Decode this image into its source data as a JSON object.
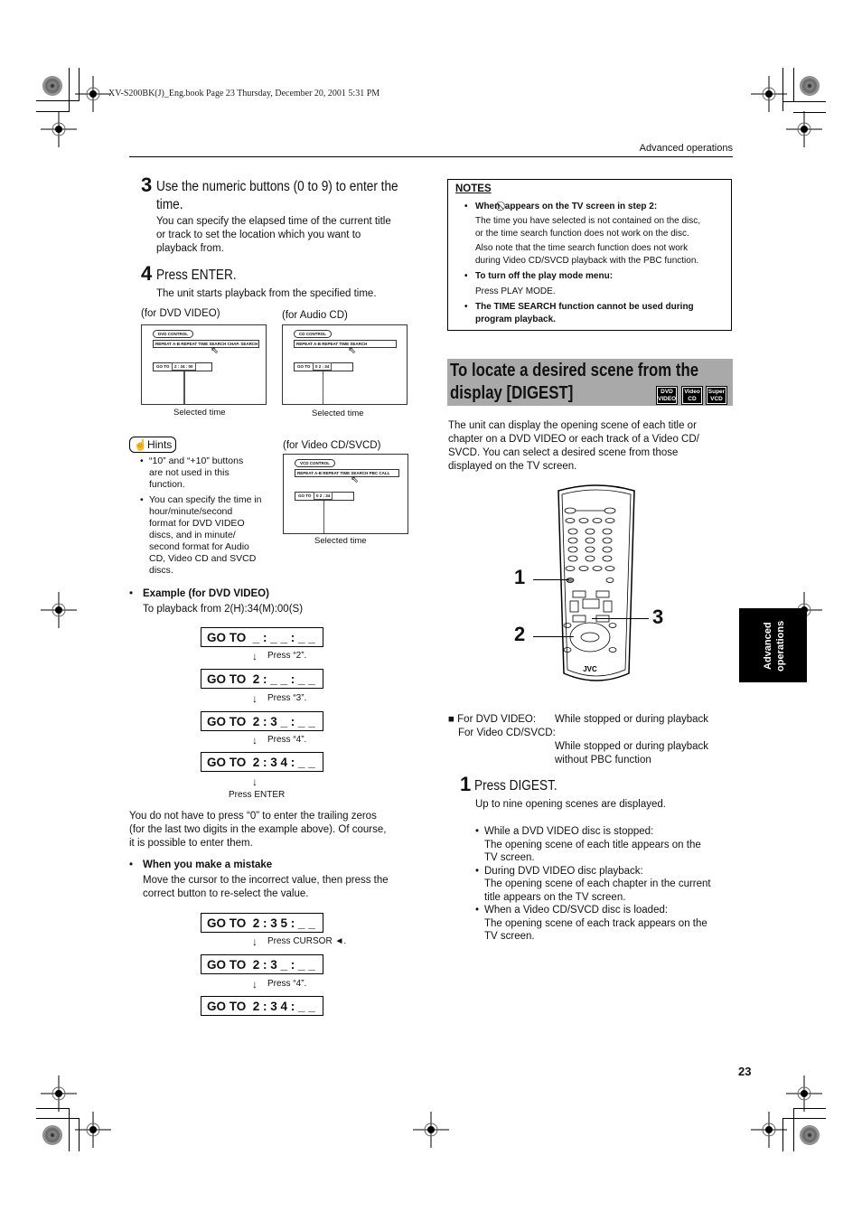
{
  "file_header": "XV-S200BK(J)_Eng.book  Page 23  Thursday, December 20, 2001  5:31 PM",
  "running_header": "Advanced operations",
  "side_tab": [
    "Advanced",
    "operations"
  ],
  "page_number": "23",
  "left_column": {
    "step3": {
      "number": "3",
      "title_line1": "Use the numeric buttons (0 to 9) to enter the",
      "title_line2": "time.",
      "body": [
        "You can specify the elapsed time of the current title",
        "or track to set the location which you want to",
        "playback from."
      ]
    },
    "step4": {
      "number": "4",
      "title": "Press ENTER.",
      "body": "The unit starts playback from the specified time."
    },
    "screens": [
      {
        "label": "(for DVD VIDEO)",
        "control": "DVD CONTROL",
        "menu": "REPEAT   A-B REPEAT   TIME SEARCH   CHAP. SEARCH",
        "goto_label": "GO TO",
        "goto_value": "2 : 34 : 00",
        "caption": "Selected time"
      },
      {
        "label": "(for Audio CD)",
        "control": "CD CONTROL",
        "menu": "REPEAT   A-B REPEAT   TIME SEARCH",
        "goto_label": "GO TO",
        "goto_value": "0 2 : 34",
        "caption": "Selected time"
      },
      {
        "label": "(for Video CD/SVCD)",
        "control": "VCD CONTROL",
        "menu": "REPEAT   A-B REPEAT   TIME SEARCH   PBC CALL",
        "goto_label": "GO TO",
        "goto_value": "0 2 : 34",
        "caption": "Selected time"
      }
    ],
    "hints": {
      "label": "Hints",
      "items": [
        [
          "“10” and “+10” buttons",
          "are not used in this",
          "function."
        ],
        [
          "You can specify the time in",
          "hour/minute/second",
          "format for DVD VIDEO",
          "discs, and in minute/",
          "second format for Audio",
          "CD, Video CD and SVCD",
          "discs."
        ]
      ]
    },
    "example": {
      "heading": "Example (for DVD VIDEO)",
      "subtext": "To playback from 2(H):34(M):00(S)",
      "sequence": [
        {
          "display": "GO TO  _ : _ _ : _ _",
          "action": "Press “2”."
        },
        {
          "display": "GO TO  2 : _ _ : _ _",
          "action": "Press “3”."
        },
        {
          "display": "GO TO  2 : 3 _ : _ _",
          "action": "Press “4”."
        },
        {
          "display": "GO TO  2 : 3 4 : _ _",
          "action": "Press ENTER"
        }
      ]
    },
    "trailing_zeros_note": [
      "You do not have to press “0” to enter the trailing zeros",
      "(for the last two digits in the example above). Of course,",
      "it is possible to enter them."
    ],
    "mistake": {
      "heading": "When you make a mistake",
      "body": [
        "Move the cursor to the incorrect value, then press the",
        "correct button to re-select the value."
      ],
      "sequence": [
        {
          "display": "GO TO  2 : 3 5 : _ _",
          "action": "Press CURSOR ◄."
        },
        {
          "display": "GO TO  2 : 3 _ : _ _",
          "action": "Press “4”."
        },
        {
          "display": "GO TO  2 : 3 4 : _ _",
          "action": ""
        }
      ]
    }
  },
  "notes": {
    "title": "NOTES",
    "item1_heading_a": "When",
    "item1_heading_b": "appears on the TV screen in step 2:",
    "item1_body1": [
      "The time you have selected is not contained on the disc,",
      "or the time search function does not work on the disc."
    ],
    "item1_body2": [
      "Also note that the time search function does not work",
      "during Video CD/SVCD playback with the PBC function."
    ],
    "item2_heading": "To turn off the play mode menu:",
    "item2_body": "Press PLAY MODE.",
    "item3": [
      "The TIME SEARCH function cannot be used during",
      "program playback."
    ]
  },
  "digest": {
    "title_line1": "To locate a desired scene from the",
    "title_line2": "display [DIGEST]",
    "badges": [
      [
        "DVD",
        "VIDEO"
      ],
      [
        "Video",
        "CD"
      ],
      [
        "Super",
        "VCD"
      ]
    ],
    "intro": [
      "The unit can display the opening scene of each title or",
      "chapter on a DVD VIDEO or each track of a Video CD/",
      "SVCD.  You can select a desired scene from those",
      "displayed on the TV screen."
    ],
    "remote_callouts": [
      "1",
      "2",
      "3"
    ],
    "remote_brand": "JVC",
    "conditions": {
      "dvd_label": "For DVD VIDEO:",
      "dvd_value": "While stopped or during playback",
      "vcd_label": "For Video CD/SVCD:",
      "vcd_value": [
        "While stopped or during playback",
        "without PBC function"
      ]
    },
    "step1": {
      "number": "1",
      "title": "Press DIGEST.",
      "body": "Up to nine opening scenes are displayed.",
      "bullets": [
        [
          "While a DVD VIDEO disc is stopped:",
          "The opening scene of each title appears on the",
          "TV screen."
        ],
        [
          "During DVD VIDEO disc playback:",
          "The opening scene of each chapter in the current",
          "title appears on the TV screen."
        ],
        [
          "When a Video CD/SVCD disc is loaded:",
          "The opening scene of each track appears on the",
          "TV screen."
        ]
      ]
    }
  }
}
